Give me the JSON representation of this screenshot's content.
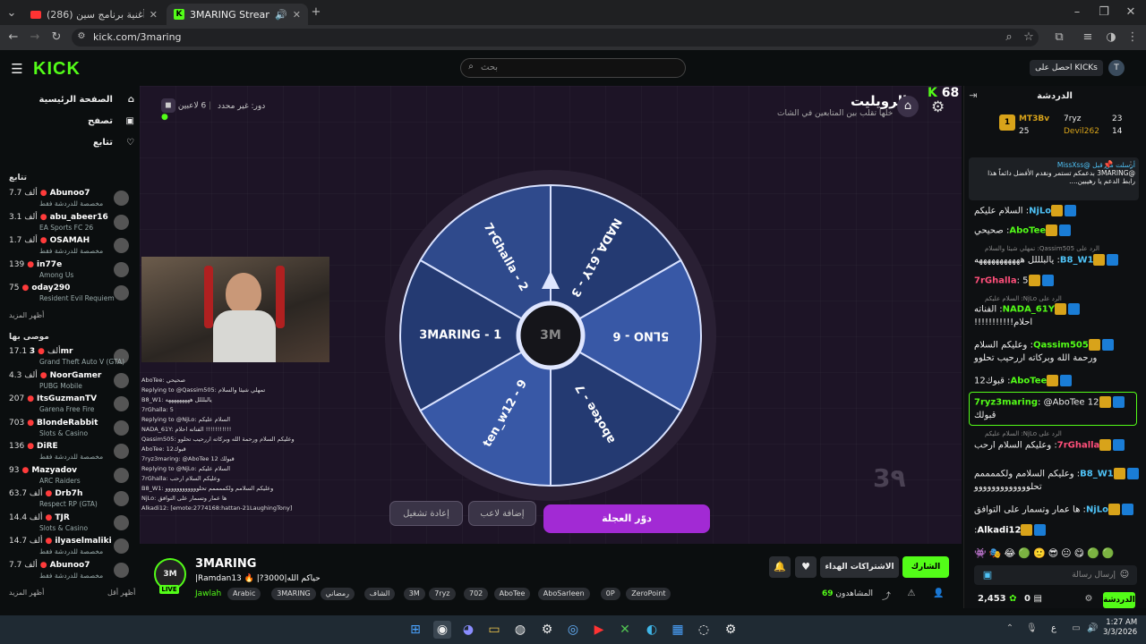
{
  "browser": {
    "tab1": "(286) أغنية برنامج سين - YouTube",
    "tab2": "3MARING Stream - Watch Live",
    "url": "kick.com/3maring"
  },
  "kick": {
    "logo": "KICK",
    "search_placeholder": "بحث",
    "kicks_button": "احصل على KICKs",
    "avatar_letter": "T"
  },
  "sidebar": {
    "nav": [
      {
        "label": "الصفحة الرئيسية",
        "icon": "home-icon"
      },
      {
        "label": "تصفح",
        "icon": "browse-icon"
      },
      {
        "label": "تتابع",
        "icon": "heart-icon"
      }
    ],
    "following_title": "تتابع",
    "following": [
      {
        "viewers": "7.7 ألف",
        "name": "Abunoo7",
        "category": "مخصصة للدردشة فقط"
      },
      {
        "viewers": "3.1 ألف",
        "name": "abu_abeer16",
        "category": "EA Sports FC 26"
      },
      {
        "viewers": "1.7 ألف",
        "name": "OSAMAH",
        "category": "مخصصة للدردشة فقط"
      },
      {
        "viewers": "139",
        "name": "in77e",
        "category": "Among Us"
      },
      {
        "viewers": "75",
        "name": "oday290",
        "category": "Resident Evil Requiem"
      }
    ],
    "show_more": "أظهر المزيد",
    "recommended_title": "موصى بها",
    "recommended": [
      {
        "viewers": "17.1 ألف",
        "name": "3mr",
        "category": "Grand Theft Auto V (GTA)"
      },
      {
        "viewers": "4.3 ألف",
        "name": "NoorGamer",
        "category": "PUBG Mobile"
      },
      {
        "viewers": "207",
        "name": "ItsGuzmanTV",
        "category": "Garena Free Fire"
      },
      {
        "viewers": "703",
        "name": "BlondeRabbit",
        "category": "Slots & Casino"
      },
      {
        "viewers": "136",
        "name": "DiRE",
        "category": "مخصصة للدردشة فقط"
      },
      {
        "viewers": "93",
        "name": "Mazyadov",
        "category": "ARC Raiders"
      },
      {
        "viewers": "63.7 ألف",
        "name": "Drb7h",
        "category": "Respect RP (GTA)"
      },
      {
        "viewers": "14.4 ألف",
        "name": "TJR",
        "category": "Slots & Casino"
      },
      {
        "viewers": "14.7 ألف",
        "name": "ilyaselmaliki",
        "category": "مخصصة للدردشة فقط"
      },
      {
        "viewers": "7.7 ألف",
        "name": "Abunoo7",
        "category": "مخصصة للدردشة فقط"
      }
    ],
    "show_less": "أظهر أقل"
  },
  "roulette": {
    "title": "الرويليت",
    "subtitle": "خلها تقلب بين المتابعين في الشات",
    "score": "68",
    "players": "6 لاعبين",
    "turn": "دور: غير محدد",
    "segments": [
      "7rGhalla - 2",
      "NADA_61Y - 3",
      "5LNO - 6",
      "abotee - 7",
      "ten_w12 - 9",
      "3MARING - 1"
    ],
    "center": "3M",
    "spin": "دوّر العجلة",
    "add_player": "إضافة لاعب",
    "restart": "إعادة تشغيل",
    "watermark": "3٩"
  },
  "overlay_chat": [
    "AboTee: صحيحي",
    "Replying to @Qassim505: تمهلي شيئا والسلام",
    "B8_W1: يالبلللل هههههههههه",
    "7rGhalla: 5",
    "Replying to @NjLo: السلام عليكم",
    "NADA_61Y: الفناته احلام !!!!!!!!!!!",
    "Qassim505: وعليكم السلام ورحمة الله وبركاته اررحيب تحلوو",
    "AboTee: قبوك12",
    "7ryz3maring: @AboTee 12 قبولك",
    "Replying to @NjLo: السلام عليكم",
    "7rGhalla: وعليكم السلام ارحب",
    "B8_W1: وعليكم السلامم ولكممممم تحلوووووووووووو",
    "NjLo: ها عمار وتسمار على التوافق",
    "Alkadi12: [emote:2774168:hattan-21LaughingTony]"
  ],
  "stream": {
    "name": "3MARING",
    "title": "حياكم الله|3000?| 🔥 Ramdan13|",
    "category": "Jawlah",
    "tags": [
      "Arabic",
      "3MARING",
      "رمضاني",
      "الشاف",
      "3M",
      "7ryz",
      "702",
      "AboTee",
      "AboSarleen",
      "0P",
      "ZeroPoint"
    ],
    "viewers_label": "المشاهدون",
    "viewers": "69",
    "follow": "الشارك",
    "subs": "الاشتراكات الهداء"
  },
  "chat": {
    "header": "الدردشة",
    "leaders": [
      {
        "name": "MT3Bv",
        "n": "25"
      },
      {
        "name": "7ryz",
        "n": "23"
      },
      {
        "name": "Devil262",
        "n": "14"
      }
    ],
    "pinned_by": "أرسلت من قبل @MissXss",
    "pinned_text": "@3MARING بدعمكم تستمر ونقدم الأفضل دائماً هذا رابط الدعم يا رهيبين....",
    "messages": [
      {
        "user": "NjLo",
        "color": "#4fc3f7",
        "text": "السلام عليكم"
      },
      {
        "user": "AboTee",
        "color": "#53fc18",
        "text": "صحيحي"
      },
      {
        "user": "B8_W1",
        "color": "#4fc3f7",
        "text": "يالبلللل هههههههههههه"
      },
      {
        "user": "7rGhalla",
        "color": "#ff4f7a",
        "text": "5"
      },
      {
        "user": "NADA_61Y",
        "color": "#53fc18",
        "text": "الفناته احلام!!!!!!!!!!!"
      },
      {
        "user": "Qassim505",
        "color": "#53fc18",
        "text": "وعليكم السلام ورحمة الله وبركاته اررحيب تحلوو"
      },
      {
        "user": "AboTee",
        "color": "#53fc18",
        "text": "قبوك12"
      },
      {
        "user": "7ryz3maring",
        "color": "#53fc18",
        "text": "@AboTee 12 قبولك"
      },
      {
        "user": "7rGhalla",
        "color": "#ff4f7a",
        "text": "وعليكم السلام ارحب"
      },
      {
        "user": "B8_W1",
        "color": "#4fc3f7",
        "text": "وعليكم السلامم ولكممممم تحلووووووووووووو"
      },
      {
        "user": "NjLo",
        "color": "#4fc3f7",
        "text": "ها عمار وتسمار على التوافق"
      },
      {
        "user": "Alkadi12",
        "color": "#ffffff",
        "text": ""
      }
    ],
    "replies": [
      "الرد على Qassim505: تمهلي شيئا والسلام",
      "الرد على NjLo: السلام عليكم",
      "الرد على NjLo: السلام عليكم"
    ],
    "input_placeholder": "إرسال رسالة",
    "points": "2,453",
    "count": "0",
    "send": "الدردشة"
  },
  "taskbar": {
    "time": "1:27 AM",
    "date": "3/3/2026",
    "lang": "ع"
  }
}
